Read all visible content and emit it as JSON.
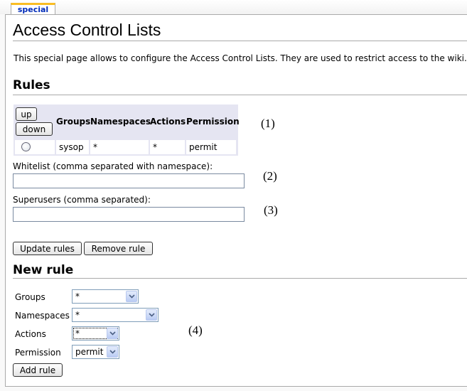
{
  "tab": {
    "label": "special"
  },
  "page": {
    "title": "Access Control Lists",
    "intro": "This special page allows to configure the Access Control Lists. They are used to restrict access to the wiki."
  },
  "rules": {
    "heading": "Rules",
    "up_label": "up",
    "down_label": "down",
    "columns": [
      "Groups",
      "Namespaces",
      "Actions",
      "Permission"
    ],
    "row": {
      "groups": "sysop",
      "namespaces": "*",
      "actions": "*",
      "permission": "permit"
    },
    "whitelist_label": "Whitelist (comma separated with namespace):",
    "whitelist_value": "",
    "superusers_label": "Superusers (comma separated):",
    "superusers_value": "",
    "update_label": "Update rules",
    "remove_label": "Remove rule"
  },
  "new_rule": {
    "heading": "New rule",
    "groups_label": "Groups",
    "groups_value": "*",
    "namespaces_label": "Namespaces",
    "namespaces_value": "*",
    "actions_label": "Actions",
    "actions_value": "*",
    "permission_label": "Permission",
    "permission_value": "permit",
    "add_label": "Add rule"
  },
  "annotations": {
    "a1": "(1)",
    "a2": "(2)",
    "a3": "(3)",
    "a4": "(4)"
  }
}
